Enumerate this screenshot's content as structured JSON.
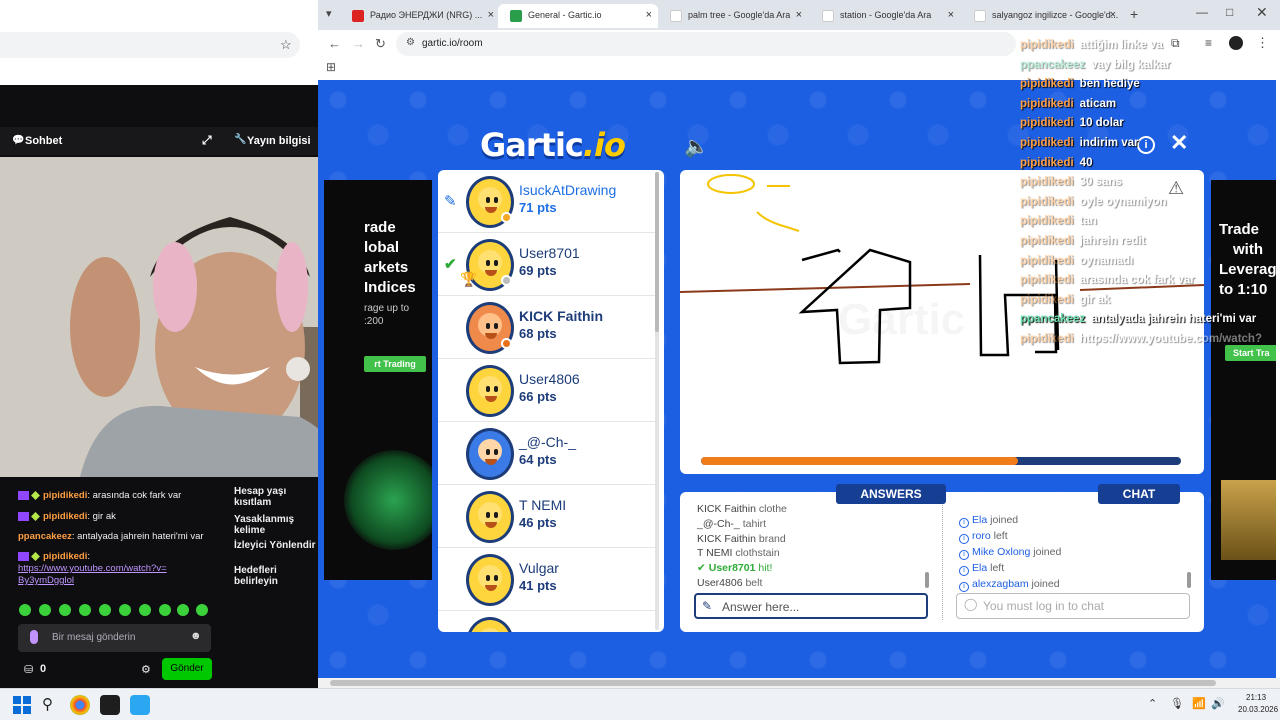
{
  "left_panel": {
    "stream_header": {
      "chat_title": "Sohbet",
      "info_title": "Yayın bilgisi"
    },
    "chat_messages": [
      {
        "user": "pipidikedi",
        "text": ": arasında cok fark var"
      },
      {
        "user": "pipidikedi",
        "text": ": gir ak"
      },
      {
        "user": "ppancakeez",
        "text": ": antalyada jahrein hateri'mi var"
      },
      {
        "user": "pipidikedi",
        "text": ":"
      }
    ],
    "chat_link": "https://www.youtube.com/watch?v=By3ymDgglol",
    "right_menu": [
      "Hesap yaşı kısıtlam",
      "Yasaklanmış kelime",
      "İzleyici Yönlendir",
      "Hedefleri belirleyin"
    ],
    "message_placeholder": "Bir mesaj gönderin",
    "points": "0",
    "send_label": "Gönder"
  },
  "browser": {
    "tabs": [
      {
        "label": "Радио ЭНЕРДЖИ (NRG) ...",
        "active": false
      },
      {
        "label": "General - Gartic.io",
        "active": true
      },
      {
        "label": "palm tree - Google'da Ara",
        "active": false
      },
      {
        "label": "station - Google'da Ara",
        "active": false
      },
      {
        "label": "salyangoz ingilizce - Google'd...",
        "active": false
      }
    ],
    "url": "gartic.io/room"
  },
  "gartic": {
    "logo_main": "Gartic",
    "logo_suffix": ".io",
    "players": [
      {
        "name": "IsuckAtDrawing",
        "pts": "71 pts",
        "state": "drawing"
      },
      {
        "name": "User8701",
        "pts": "69 pts",
        "state": "hit"
      },
      {
        "name": "KICK Faithin",
        "pts": "68 pts",
        "state": "none"
      },
      {
        "name": "User4806",
        "pts": "66 pts",
        "state": "none"
      },
      {
        "name": "_@-Ch-_",
        "pts": "64 pts",
        "state": "none"
      },
      {
        "name": "T NEMI",
        "pts": "46 pts",
        "state": "none"
      },
      {
        "name": "Vulgar",
        "pts": "41 pts",
        "state": "none"
      }
    ],
    "timer_fraction": 0.66,
    "answers_title": "ANSWERS",
    "chat_title": "CHAT",
    "answers": [
      {
        "user": "KICK Faithin",
        "text": "clothe",
        "hit": false
      },
      {
        "user": "_@-Ch-_",
        "text": "tahirt",
        "hit": false
      },
      {
        "user": "KICK Faithin",
        "text": "brand",
        "hit": false
      },
      {
        "user": "T NEMI",
        "text": "clothstain",
        "hit": false
      },
      {
        "user": "User8701",
        "text": "hit!",
        "hit": true
      },
      {
        "user": "User4806",
        "text": "belt",
        "hit": false
      }
    ],
    "chat_events": [
      {
        "user": "Ela",
        "text": "joined"
      },
      {
        "user": "roro",
        "text": "left"
      },
      {
        "user": "Mike Oxlong",
        "text": "joined"
      },
      {
        "user": "Ela",
        "text": "left"
      },
      {
        "user": "alexzagbam",
        "text": "joined"
      }
    ],
    "answer_placeholder": "Answer here...",
    "chat_placeholder": "You must log in to chat",
    "ad_left": {
      "line1": "rade",
      "line2": "lobal",
      "line3": "arkets",
      "line4": "Indices",
      "line5": "rage up to",
      "line6": ":200",
      "cta": "rt Trading"
    },
    "ad_right": {
      "line1": "Trade",
      "line2": "with",
      "line3": "Leverag",
      "line4": "to 1:10",
      "cta": "Start Tra"
    }
  },
  "overlay_chat": [
    {
      "user": "pipidikedi",
      "text": "attiğim linke va",
      "fade": true
    },
    {
      "user": "ppancakeez",
      "text": "vay bilg kalkar",
      "fade": true
    },
    {
      "user": "pipidikedi",
      "text": "ben hediye",
      "fade": false
    },
    {
      "user": "pipidikedi",
      "text": "aticam",
      "fade": false
    },
    {
      "user": "pipidikedi",
      "text": "10 dolar",
      "fade": false
    },
    {
      "user": "pipidikedi",
      "text": "indirim var",
      "fade": false
    },
    {
      "user": "pipidikedi",
      "text": "40",
      "fade": false
    },
    {
      "user": "pipidikedi",
      "text": "30 sans",
      "fade": true
    },
    {
      "user": "pipidikedi",
      "text": "oyle oynamiyon",
      "fade": true
    },
    {
      "user": "pipidikedi",
      "text": "tan",
      "fade": true
    },
    {
      "user": "pipidikedi",
      "text": "jahrein redit",
      "fade": true
    },
    {
      "user": "pipidikedi",
      "text": "oynamadı",
      "fade": true
    },
    {
      "user": "pipidikedi",
      "text": "arasında cok fark var",
      "fade": true
    },
    {
      "user": "pipidikedi",
      "text": "gir ak",
      "fade": true
    },
    {
      "user": "ppancakeez",
      "text": "antalyada jahrein hateri'mi var",
      "fade": false
    },
    {
      "user": "pipidikedi",
      "text": "https://www.youtube.com/watch?",
      "fade": true
    }
  ],
  "overlay_chat_tail": "v=By3ymDgglol",
  "taskbar": {
    "time": "21:13",
    "date": "20.03.2026"
  },
  "colors": {
    "gartic_blue": "#1d5fe3",
    "navy": "#1d3c7a",
    "timer_orange": "#f07d1a",
    "twitch_purple": "#9146ff"
  }
}
